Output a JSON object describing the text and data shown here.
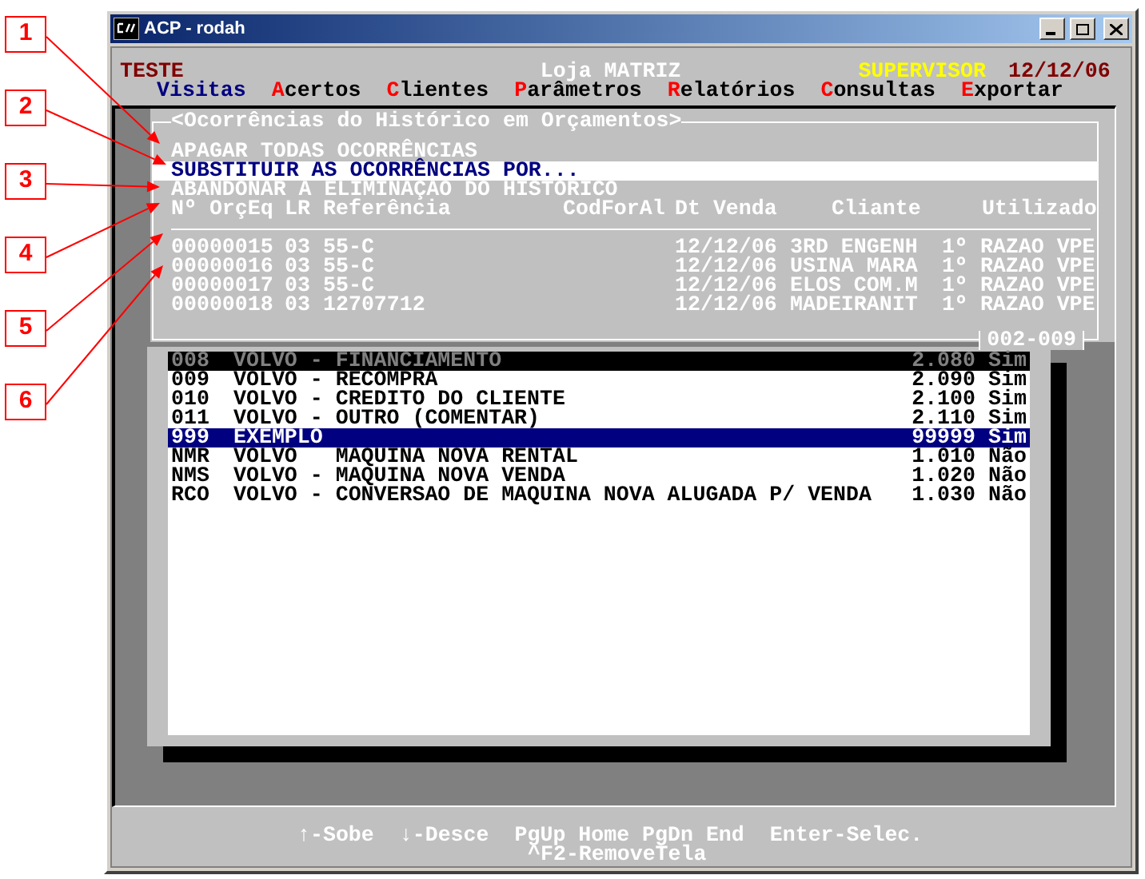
{
  "annotations": [
    "1",
    "2",
    "3",
    "4",
    "5",
    "6"
  ],
  "window": {
    "title": "ACP - rodah"
  },
  "header": {
    "company": "TESTE",
    "store": "Loja MATRIZ",
    "user": "SUPERVISOR",
    "date": "12/12/06"
  },
  "menu": [
    {
      "label": "Visitas",
      "selected": true
    },
    {
      "label": "Acertos",
      "selected": false
    },
    {
      "label": "Clientes",
      "selected": false
    },
    {
      "label": "Parâmetros",
      "selected": false
    },
    {
      "label": "Relatórios",
      "selected": false
    },
    {
      "label": "Consultas",
      "selected": false
    },
    {
      "label": "Exportar",
      "selected": false
    }
  ],
  "dialog": {
    "title": "<Ocorrências do Histórico em Orçamentos>",
    "options": [
      {
        "label": "APAGAR TODAS OCORRÊNCIAS",
        "selected": false
      },
      {
        "label": "SUBSTITUIR AS OCORRÊNCIAS POR...",
        "selected": true
      },
      {
        "label": "ABANDONAR A ELIMINAÇÃO DO HISTÓRICO",
        "selected": false
      }
    ],
    "columns": [
      "Nº OrçEq",
      "LR",
      "Referência",
      "CodForAl",
      "Dt Venda",
      "Cliante",
      "Utilizado"
    ],
    "rows": [
      {
        "orc": "00000015",
        "lr": "03",
        "ref": "55-C",
        "dt": "12/12/06",
        "cliente": "3RD ENGENH",
        "utilizado": "1º RAZAO VPE"
      },
      {
        "orc": "00000016",
        "lr": "03",
        "ref": "55-C",
        "dt": "12/12/06",
        "cliente": "USINA MARA",
        "utilizado": "1º RAZAO VPE"
      },
      {
        "orc": "00000017",
        "lr": "03",
        "ref": "55-C",
        "dt": "12/12/06",
        "cliente": "ELOS COM.M",
        "utilizado": "1º RAZAO VPE"
      },
      {
        "orc": "00000018",
        "lr": "03",
        "ref": "12707712",
        "dt": "12/12/06",
        "cliente": "MADEIRANIT",
        "utilizado": "1º RAZAO VPE"
      }
    ],
    "page_counter": "002-009"
  },
  "list": {
    "rows": [
      {
        "code": "008",
        "desc": "VOLVO - FINANCIAMENTO",
        "value": "2.080",
        "flag": "Sim",
        "selected": false,
        "disabled": true
      },
      {
        "code": "009",
        "desc": "VOLVO - RECOMPRA",
        "value": "2.090",
        "flag": "Sim",
        "selected": false,
        "disabled": false
      },
      {
        "code": "010",
        "desc": "VOLVO - CREDITO DO CLIENTE",
        "value": "2.100",
        "flag": "Sim",
        "selected": false,
        "disabled": false
      },
      {
        "code": "011",
        "desc": "VOLVO - OUTRO (COMENTAR)",
        "value": "2.110",
        "flag": "Sim",
        "selected": false,
        "disabled": false
      },
      {
        "code": "999",
        "desc": "EXEMPLO",
        "value": "99999",
        "flag": "Sim",
        "selected": true,
        "disabled": false
      },
      {
        "code": "NMR",
        "desc": "VOLVO   MAQUINA NOVA RENTAL",
        "value": "1.010",
        "flag": "Não",
        "selected": false,
        "disabled": false
      },
      {
        "code": "NMS",
        "desc": "VOLVO - MAQUINA NOVA VENDA",
        "value": "1.020",
        "flag": "Não",
        "selected": false,
        "disabled": false
      },
      {
        "code": "RCO",
        "desc": "VOLVO - CONVERSAO DE MAQUINA NOVA ALUGADA P/ VENDA",
        "value": "1.030",
        "flag": "Não",
        "selected": false,
        "disabled": false
      }
    ]
  },
  "help": [
    "↑-Sobe",
    "↓-Desce",
    "PgUp Home PgDn End",
    "Enter-Selec."
  ],
  "help_second_line": "^F2-RemoveTela"
}
